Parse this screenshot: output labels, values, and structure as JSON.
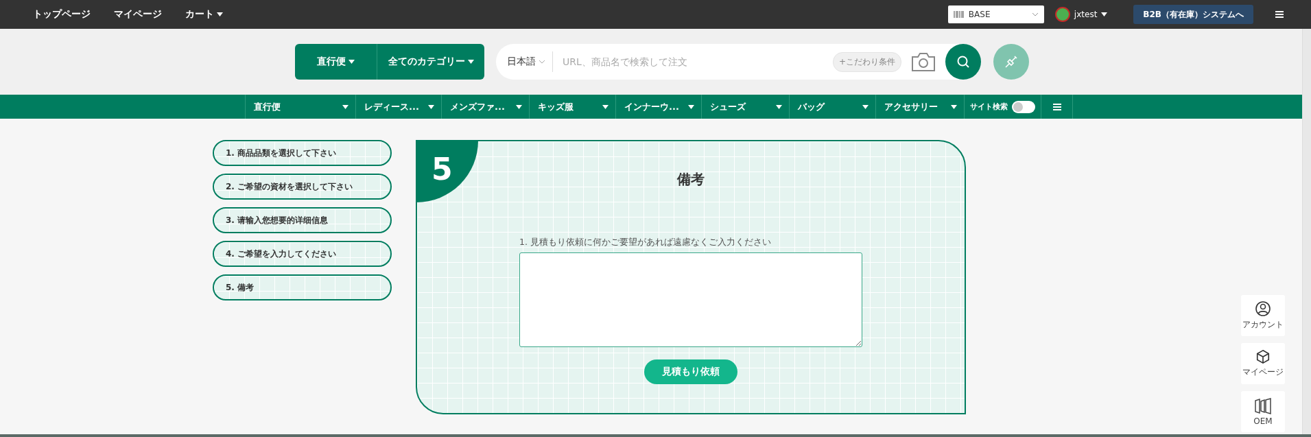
{
  "top_bar": {
    "links": [
      {
        "label": "トップページ",
        "dropdown": false
      },
      {
        "label": "マイページ",
        "dropdown": false
      },
      {
        "label": "カート",
        "dropdown": true
      }
    ],
    "store_select": {
      "value": "BASE"
    },
    "user": {
      "name": "jxtest"
    },
    "b2b_button": "B2B（有在庫）システムへ"
  },
  "search": {
    "shipping": "直行便",
    "category": "全てのカテゴリー",
    "language": "日本語",
    "placeholder": "URL、商品名で検索して注文",
    "filter_chip": "+こだわり条件"
  },
  "nav": {
    "items": [
      {
        "label": "直行便"
      },
      {
        "label": "レディース..."
      },
      {
        "label": "メンズファ..."
      },
      {
        "label": "キッズ服"
      },
      {
        "label": "インナーウ..."
      },
      {
        "label": "シューズ"
      },
      {
        "label": "バッグ"
      },
      {
        "label": "アクセサリー"
      }
    ],
    "site_search": {
      "label": "サイト検索",
      "on": false
    }
  },
  "steps": [
    {
      "label": "1. 商品品類を選択して下さい"
    },
    {
      "label": "2. ご希望の資材を選択して下さい"
    },
    {
      "label": "3. 请输入您想要的详细信息"
    },
    {
      "label": "4. ご希望を入力してください"
    },
    {
      "label": "5. 備考"
    }
  ],
  "panel": {
    "number": "5",
    "title": "備考",
    "field_label": "1. 見積もり依頼に何かご要望があれば遠慮なくご入力ください",
    "submit": "見積もり依頼"
  },
  "float_menu": [
    {
      "kind": "account",
      "label": "アカウント"
    },
    {
      "kind": "box",
      "label": "マイページ"
    },
    {
      "kind": "oem",
      "label": "OEM"
    }
  ]
}
